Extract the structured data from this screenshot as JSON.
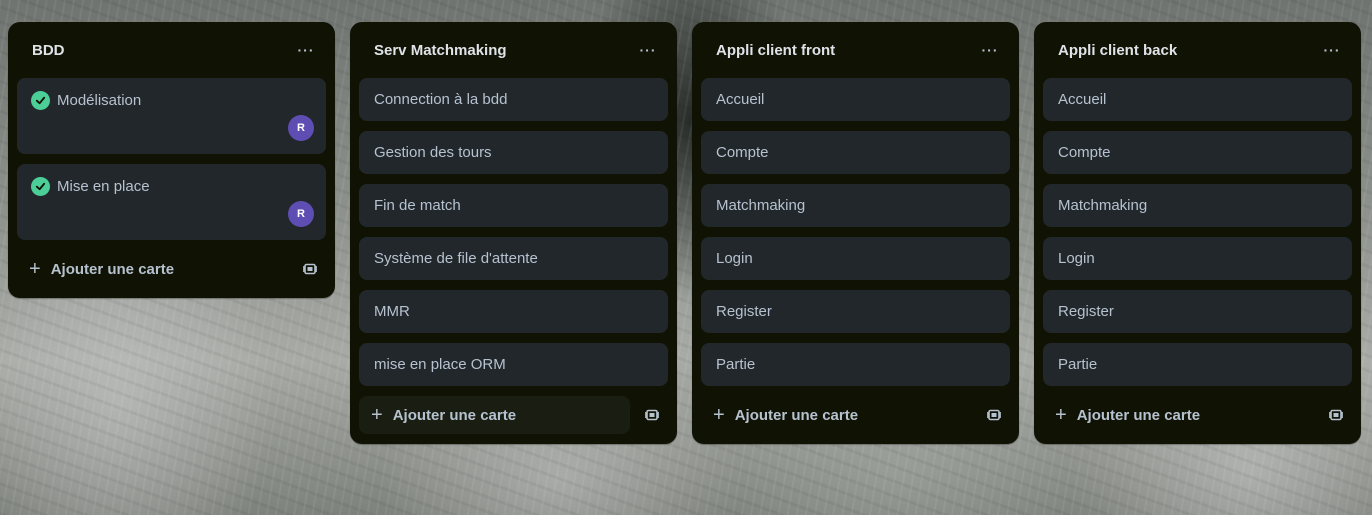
{
  "columns": [
    {
      "title": "BDD",
      "menu_label": "···",
      "cards": [
        {
          "title": "Modélisation",
          "avatar": "R"
        },
        {
          "title": "Mise en place",
          "avatar": "R"
        }
      ],
      "add_label": "Ajouter une carte"
    },
    {
      "title": "Serv Matchmaking",
      "menu_label": "···",
      "cards": [
        {
          "title": "Connection à la bdd"
        },
        {
          "title": "Gestion des tours"
        },
        {
          "title": "Fin de match"
        },
        {
          "title": "Système de file d'attente"
        },
        {
          "title": "MMR"
        },
        {
          "title": "mise en place ORM"
        }
      ],
      "add_label": "Ajouter une carte"
    },
    {
      "title": "Appli client front",
      "menu_label": "···",
      "cards": [
        {
          "title": "Accueil"
        },
        {
          "title": "Compte"
        },
        {
          "title": "Matchmaking"
        },
        {
          "title": "Login"
        },
        {
          "title": "Register"
        },
        {
          "title": "Partie"
        }
      ],
      "add_label": "Ajouter une carte"
    },
    {
      "title": "Appli client back",
      "menu_label": "···",
      "cards": [
        {
          "title": "Accueil"
        },
        {
          "title": "Compte"
        },
        {
          "title": "Matchmaking"
        },
        {
          "title": "Login"
        },
        {
          "title": "Register"
        },
        {
          "title": "Partie"
        }
      ],
      "add_label": "Ajouter une carte"
    }
  ],
  "colors": {
    "column_bg": "#101204",
    "card_bg": "#22272b",
    "text": "#b6c2cf",
    "done_green": "#4bce97",
    "avatar_purple": "#5e4db2"
  },
  "icons": {
    "card_done": "check-circle-icon",
    "add": "plus-icon",
    "template": "card-template-icon",
    "menu": "ellipsis-icon"
  }
}
